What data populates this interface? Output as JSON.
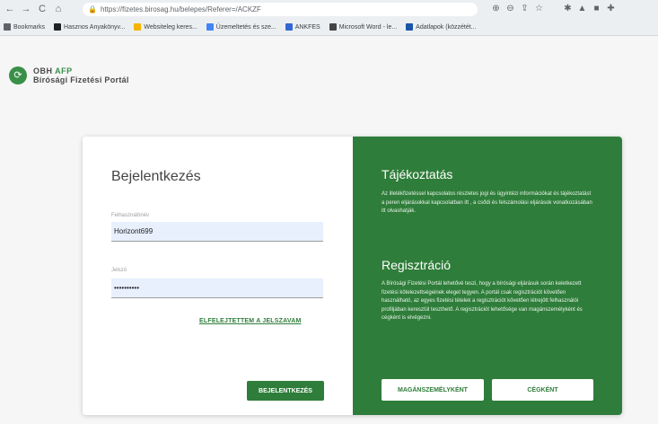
{
  "browser": {
    "url": "https://fizetes.birosag.hu/belepes/Referer=/ACKZF",
    "nav": {
      "back": "←",
      "forward": "→",
      "reload": "C",
      "home": "⌂"
    },
    "bookmarks": [
      {
        "label": "Bookmarks",
        "color": "#5f6368"
      },
      {
        "label": "Hasznos Anyakönyv...",
        "color": "#202124"
      },
      {
        "label": "Websiteleg keres...",
        "color": "#f4b400"
      },
      {
        "label": "Üzemeltetés és sze...",
        "color": "#4285f4"
      },
      {
        "label": "ANKFES",
        "color": "#3367d6"
      },
      {
        "label": "Microsoft Word - le...",
        "color": "#444444"
      },
      {
        "label": "Adatlapok (közzétét...",
        "color": "#1a55a8"
      }
    ]
  },
  "site": {
    "brand_line1_prefix": "OBH ",
    "brand_line1_accent": "AFP",
    "brand_line2": "Bírósági Fizetési Portál",
    "logo_glyph": "⟳"
  },
  "login": {
    "title": "Bejelentkezés",
    "username_label": "Felhasználónév",
    "username_value": "Horizont699",
    "password_label": "Jelszó",
    "password_value": "••••••••••",
    "forgot_label": "ELFELEJTETTEM A JELSZAVAM",
    "login_button": "BEJELENTKEZÉS"
  },
  "info": {
    "title": "Tájékoztatás",
    "text": "Az illetékfizetéssel kapcsolatos részletes jogi és ügyintézi információkat és tájékoztatást a peren eljárásokkal kapcsolatban itt , a csődi és felszámolási eljárások vonatkozásában itt olvashatják.",
    "registration_title": "Regisztráció",
    "registration_text": "A Bírósági Fizetési Portál lehetővé teszi, hogy a bírósági eljárásuk során keletkezett fizetési kötelezettségeinek eleget tegyen. A portál csak regisztrációt követően használható, az egyes fizetési tételek a regisztrációt követően létrejött felhasználói profiljában keresztül teszthető. A regisztrációt lehetősége van magánszemélyként és cégként is elvégezni.",
    "private_button": "MAGÁNSZEMÉLYKÉNT",
    "company_button": "CÉGKÉNT"
  },
  "colors": {
    "brand_green": "#2f7d3a",
    "field_bg": "#e8f0fe"
  }
}
